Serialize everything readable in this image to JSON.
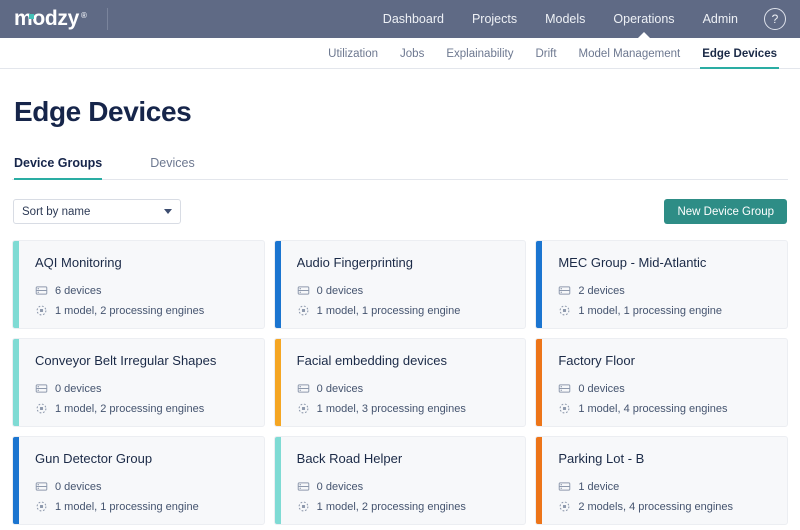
{
  "header": {
    "logo_text": "modzy",
    "logo_registered": "®",
    "nav": [
      {
        "label": "Dashboard",
        "active": false
      },
      {
        "label": "Projects",
        "active": false
      },
      {
        "label": "Models",
        "active": false
      },
      {
        "label": "Operations",
        "active": true
      },
      {
        "label": "Admin",
        "active": false
      }
    ],
    "help_icon": "?",
    "help_icon_name": "help-circle-icon"
  },
  "subnav": [
    {
      "label": "Utilization",
      "active": false
    },
    {
      "label": "Jobs",
      "active": false
    },
    {
      "label": "Explainability",
      "active": false
    },
    {
      "label": "Drift",
      "active": false
    },
    {
      "label": "Model Management",
      "active": false
    },
    {
      "label": "Edge Devices",
      "active": true
    }
  ],
  "page": {
    "title": "Edge Devices",
    "tabs": [
      {
        "label": "Device Groups",
        "active": true
      },
      {
        "label": "Devices",
        "active": false
      }
    ]
  },
  "toolbar": {
    "sort_value": "Sort by name",
    "new_group_label": "New Device Group"
  },
  "colors": {
    "topbar": "#5f6a85",
    "accent_teal": "#2aada3",
    "button_teal": "#2e8d86",
    "accent_light_teal": "#7fdbd4",
    "accent_blue": "#1b75d0",
    "accent_orange": "#f5a623",
    "accent_deep_orange": "#ed7519",
    "card_bg": "#f7f8fa",
    "title_navy": "#16254a"
  },
  "device_groups": [
    {
      "name": "AQI Monitoring",
      "devices": "6 devices",
      "models": "1 model, 2 processing engines",
      "accent": "#7fdbd4"
    },
    {
      "name": "Audio Fingerprinting",
      "devices": "0 devices",
      "models": "1 model, 1 processing engine",
      "accent": "#1b75d0"
    },
    {
      "name": "MEC Group - Mid-Atlantic",
      "devices": "2 devices",
      "models": "1 model, 1 processing engine",
      "accent": "#1b75d0"
    },
    {
      "name": "Conveyor Belt Irregular Shapes",
      "devices": "0 devices",
      "models": "1 model, 2 processing engines",
      "accent": "#7fdbd4"
    },
    {
      "name": "Facial embedding devices",
      "devices": "0 devices",
      "models": "1 model, 3 processing engines",
      "accent": "#f5a623"
    },
    {
      "name": "Factory Floor",
      "devices": "0 devices",
      "models": "1 model, 4 processing engines",
      "accent": "#ed7519"
    },
    {
      "name": "Gun Detector Group",
      "devices": "0 devices",
      "models": "1 model, 1 processing engine",
      "accent": "#1b75d0"
    },
    {
      "name": "Back Road Helper",
      "devices": "0 devices",
      "models": "1 model, 2 processing engines",
      "accent": "#7fdbd4"
    },
    {
      "name": "Parking Lot - B",
      "devices": "1 device",
      "models": "2 models, 4 processing engines",
      "accent": "#ed7519"
    }
  ],
  "icons": {
    "device_icon": "device-icon",
    "engine_icon": "processing-engine-icon"
  }
}
